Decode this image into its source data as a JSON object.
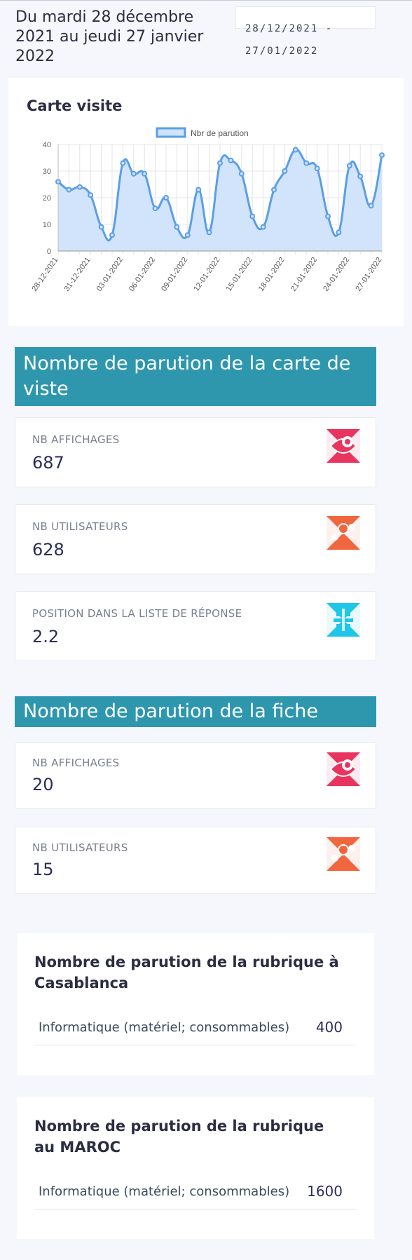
{
  "header": {
    "period_text": "Du mardi 28 décembre 2021 au jeudi 27 janvier 2022",
    "date_range_start": "28/12/2021 -",
    "date_range_end": "27/01/2022"
  },
  "chart_card": {
    "title": "Carte visite"
  },
  "chart_data": {
    "type": "area",
    "legend": "Nbr de parution",
    "legend_position": "top",
    "ylim": [
      0,
      40
    ],
    "yticks": [
      0,
      10,
      20,
      30,
      40
    ],
    "grid": true,
    "x": [
      "28-12-2021",
      "29-12-2021",
      "30-12-2021",
      "31-12-2021",
      "01-01-2022",
      "02-01-2022",
      "03-01-2022",
      "04-01-2022",
      "05-01-2022",
      "06-01-2022",
      "07-01-2022",
      "08-01-2022",
      "09-01-2022",
      "10-01-2022",
      "11-01-2022",
      "12-01-2022",
      "13-01-2022",
      "14-01-2022",
      "15-01-2022",
      "16-01-2022",
      "17-01-2022",
      "18-01-2022",
      "19-01-2022",
      "20-01-2022",
      "21-01-2022",
      "22-01-2022",
      "23-01-2022",
      "24-01-2022",
      "25-01-2022",
      "26-01-2022",
      "27-01-2022"
    ],
    "xtick_labels": [
      "28-12-2021",
      "31-12-2021",
      "03-01-2022",
      "06-01-2022",
      "09-01-2022",
      "12-01-2022",
      "15-01-2022",
      "18-01-2022",
      "21-01-2022",
      "24-01-2022",
      "27-01-2022"
    ],
    "series": [
      {
        "name": "Nbr de parution",
        "values": [
          26,
          23,
          24,
          21,
          9,
          6,
          33,
          29,
          29,
          16,
          20,
          9,
          6,
          23,
          7,
          33,
          34,
          29,
          13,
          9,
          23,
          30,
          38,
          33,
          31,
          13,
          7,
          32,
          28,
          17,
          36
        ]
      }
    ],
    "colors": {
      "line": "#5b9ee6",
      "fill": "#cfe3fb",
      "grid": "#e4e4e4"
    }
  },
  "section_carte": {
    "title": "Nombre de parution de la carte de viste",
    "stats": [
      {
        "label": "NB AFFICHAGES",
        "value": "687",
        "icon": "eye-icon",
        "color": "#e8345f"
      },
      {
        "label": "NB UTILISATEURS",
        "value": "628",
        "icon": "users-icon",
        "color": "#f0663e"
      },
      {
        "label": "POSITION DANS LA LISTE DE RÉPONSE",
        "value": "2.2",
        "icon": "list-position-icon",
        "color": "#1fc6e8"
      }
    ]
  },
  "section_fiche": {
    "title": "Nombre de parution de la fiche",
    "stats": [
      {
        "label": "NB AFFICHAGES",
        "value": "20",
        "icon": "eye-icon",
        "color": "#e8345f"
      },
      {
        "label": "NB UTILISATEURS",
        "value": "15",
        "icon": "users-icon",
        "color": "#f0663e"
      }
    ]
  },
  "rubric_casablanca": {
    "title": "Nombre de parution de la rubrique à Casablanca",
    "rows": [
      {
        "name": "Informatique (matériel; consommables)",
        "count": "400"
      }
    ]
  },
  "rubric_maroc": {
    "title": "Nombre de parution de la rubrique au MAROC",
    "rows": [
      {
        "name": "Informatique (matériel; consommables)",
        "count": "1600"
      }
    ]
  }
}
